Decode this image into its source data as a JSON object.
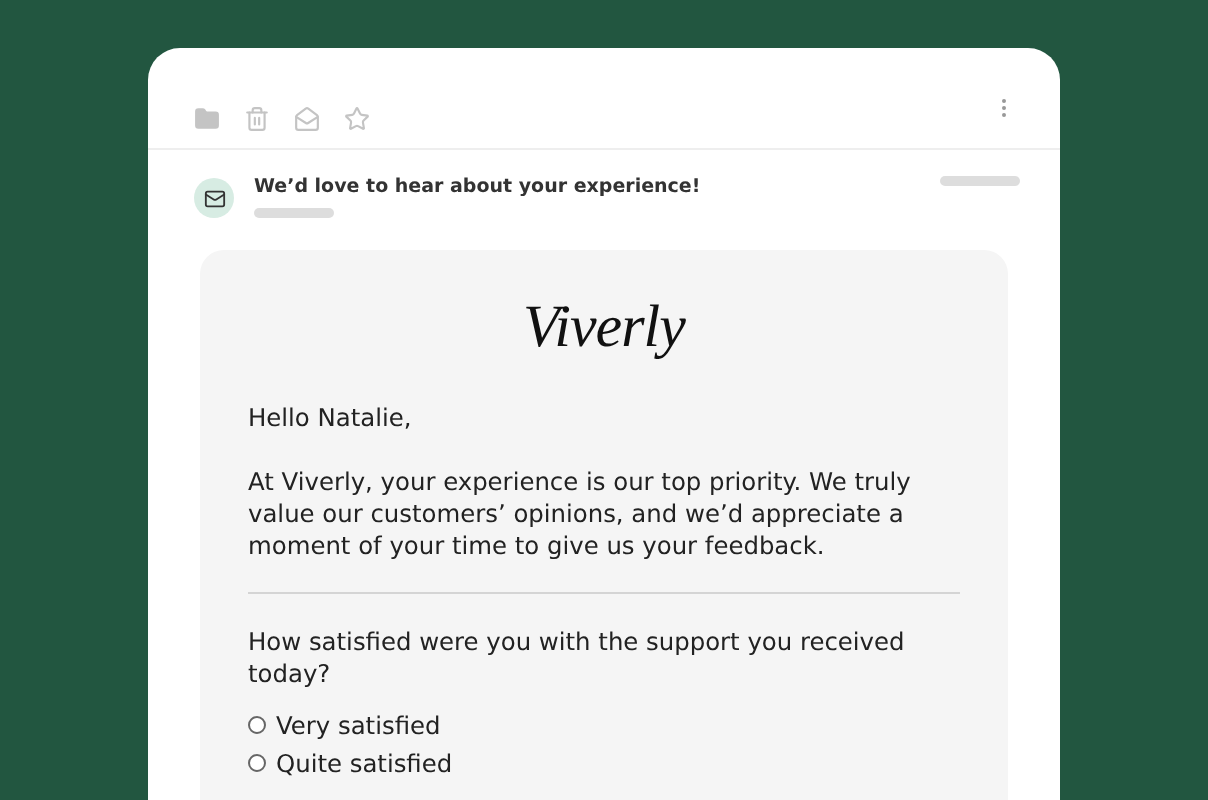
{
  "email": {
    "subject": "We’d love to hear about your experience!"
  },
  "message": {
    "logo": "Viverly",
    "greeting": "Hello Natalie,",
    "body": "At Viverly, your experience is our top priority. We truly value our customers’ opinions, and we’d appreciate a moment of your time to give us your feedback.",
    "question": "How satisfied were you with the support you received today?",
    "options": [
      {
        "label": "Very satisfied",
        "selected": false
      },
      {
        "label": "Quite satisfied",
        "selected": false
      }
    ]
  }
}
